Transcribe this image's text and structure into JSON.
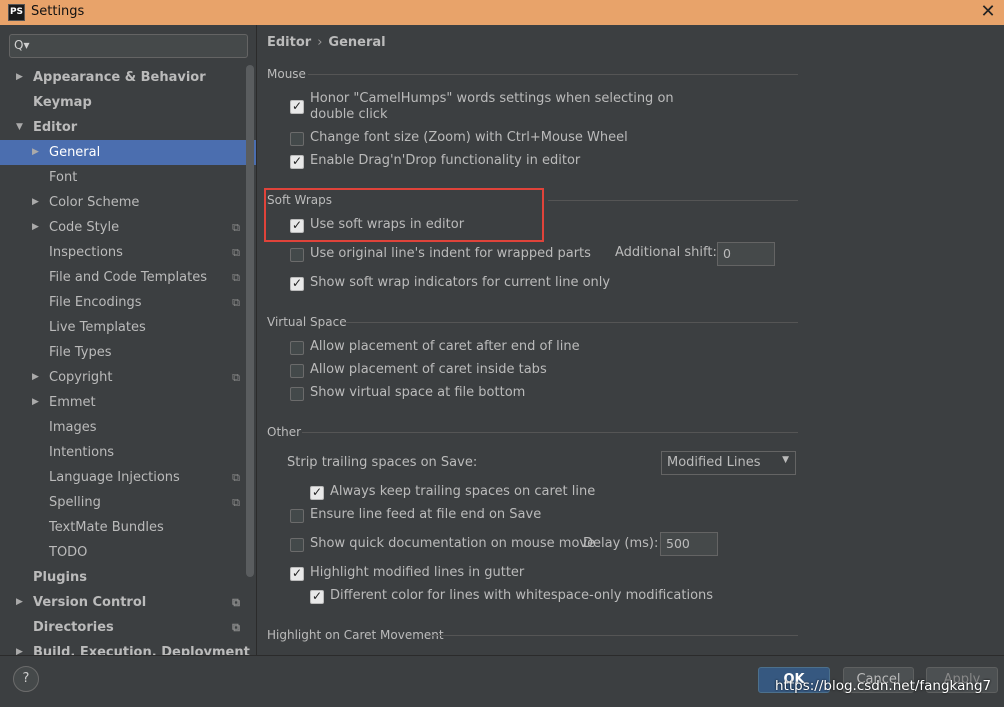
{
  "window": {
    "title": "Settings",
    "app_icon_text": "PS",
    "close_glyph": "✕"
  },
  "search": {
    "icon": "Q▾",
    "value": ""
  },
  "sidebar": {
    "items": [
      {
        "label": "Appearance & Behavior",
        "arrow": "▶",
        "bold": true,
        "level": 0,
        "selected": false,
        "project": false
      },
      {
        "label": "Keymap",
        "arrow": "",
        "bold": true,
        "level": 0,
        "selected": false,
        "project": false
      },
      {
        "label": "Editor",
        "arrow": "▼",
        "bold": true,
        "level": 0,
        "selected": false,
        "project": false
      },
      {
        "label": "General",
        "arrow": "▶",
        "bold": false,
        "level": 1,
        "selected": true,
        "project": false
      },
      {
        "label": "Font",
        "arrow": "",
        "bold": false,
        "level": 1,
        "selected": false,
        "project": false
      },
      {
        "label": "Color Scheme",
        "arrow": "▶",
        "bold": false,
        "level": 1,
        "selected": false,
        "project": false
      },
      {
        "label": "Code Style",
        "arrow": "▶",
        "bold": false,
        "level": 1,
        "selected": false,
        "project": true
      },
      {
        "label": "Inspections",
        "arrow": "",
        "bold": false,
        "level": 1,
        "selected": false,
        "project": true
      },
      {
        "label": "File and Code Templates",
        "arrow": "",
        "bold": false,
        "level": 1,
        "selected": false,
        "project": true
      },
      {
        "label": "File Encodings",
        "arrow": "",
        "bold": false,
        "level": 1,
        "selected": false,
        "project": true
      },
      {
        "label": "Live Templates",
        "arrow": "",
        "bold": false,
        "level": 1,
        "selected": false,
        "project": false
      },
      {
        "label": "File Types",
        "arrow": "",
        "bold": false,
        "level": 1,
        "selected": false,
        "project": false
      },
      {
        "label": "Copyright",
        "arrow": "▶",
        "bold": false,
        "level": 1,
        "selected": false,
        "project": true
      },
      {
        "label": "Emmet",
        "arrow": "▶",
        "bold": false,
        "level": 1,
        "selected": false,
        "project": false
      },
      {
        "label": "Images",
        "arrow": "",
        "bold": false,
        "level": 1,
        "selected": false,
        "project": false
      },
      {
        "label": "Intentions",
        "arrow": "",
        "bold": false,
        "level": 1,
        "selected": false,
        "project": false
      },
      {
        "label": "Language Injections",
        "arrow": "",
        "bold": false,
        "level": 1,
        "selected": false,
        "project": true
      },
      {
        "label": "Spelling",
        "arrow": "",
        "bold": false,
        "level": 1,
        "selected": false,
        "project": true
      },
      {
        "label": "TextMate Bundles",
        "arrow": "",
        "bold": false,
        "level": 1,
        "selected": false,
        "project": false
      },
      {
        "label": "TODO",
        "arrow": "",
        "bold": false,
        "level": 1,
        "selected": false,
        "project": false
      },
      {
        "label": "Plugins",
        "arrow": "",
        "bold": true,
        "level": 0,
        "selected": false,
        "project": false
      },
      {
        "label": "Version Control",
        "arrow": "▶",
        "bold": true,
        "level": 0,
        "selected": false,
        "project": true
      },
      {
        "label": "Directories",
        "arrow": "",
        "bold": true,
        "level": 0,
        "selected": false,
        "project": true
      },
      {
        "label": "Build, Execution, Deployment",
        "arrow": "▶",
        "bold": true,
        "level": 0,
        "selected": false,
        "project": false
      }
    ],
    "project_icon": "⧉"
  },
  "breadcrumb": {
    "parent": "Editor",
    "separator": "›",
    "current": "General"
  },
  "sections": {
    "mouse": {
      "title": "Mouse",
      "camel_humps_line1": "Honor \"CamelHumps\" words settings when selecting on",
      "camel_humps_line2": "double click",
      "camel_humps_checked": true,
      "font_zoom": "Change font size (Zoom) with Ctrl+Mouse Wheel",
      "font_zoom_checked": false,
      "drag_drop": "Enable Drag'n'Drop functionality in editor",
      "drag_drop_checked": true
    },
    "soft_wraps": {
      "title": "Soft Wraps",
      "use_soft_wraps": "Use soft wraps in editor",
      "use_soft_wraps_checked": true,
      "original_indent": "Use original line's indent for wrapped parts",
      "original_indent_checked": false,
      "additional_shift_label": "Additional shift:",
      "additional_shift_value": "0",
      "indicators": "Show soft wrap indicators for current line only",
      "indicators_checked": true
    },
    "virtual_space": {
      "title": "Virtual Space",
      "after_end": "Allow placement of caret after end of line",
      "after_end_checked": false,
      "inside_tabs": "Allow placement of caret inside tabs",
      "inside_tabs_checked": false,
      "file_bottom": "Show virtual space at file bottom",
      "file_bottom_checked": false
    },
    "other": {
      "title": "Other",
      "strip_label": "Strip trailing spaces on Save:",
      "strip_value": "Modified Lines",
      "keep_trailing": "Always keep trailing spaces on caret line",
      "keep_trailing_checked": true,
      "line_feed": "Ensure line feed at file end on Save",
      "line_feed_checked": false,
      "quick_doc": "Show quick documentation on mouse move",
      "quick_doc_checked": false,
      "delay_label": "Delay (ms):",
      "delay_value": "500",
      "highlight_modified": "Highlight modified lines in gutter",
      "highlight_modified_checked": true,
      "different_color": "Different color for lines with whitespace-only modifications",
      "different_color_checked": true
    },
    "caret_movement": {
      "title": "Highlight on Caret Movement"
    }
  },
  "footer": {
    "help": "?",
    "ok": "OK",
    "cancel": "Cancel",
    "apply": "Apply"
  },
  "watermark": "https://blog.csdn.net/fangkang7",
  "colors": {
    "selection": "#4b6eaf",
    "background": "#3c3f41",
    "titlebar": "#e8a36a",
    "highlight_box": "#e0433a",
    "ok_button": "#365880"
  }
}
